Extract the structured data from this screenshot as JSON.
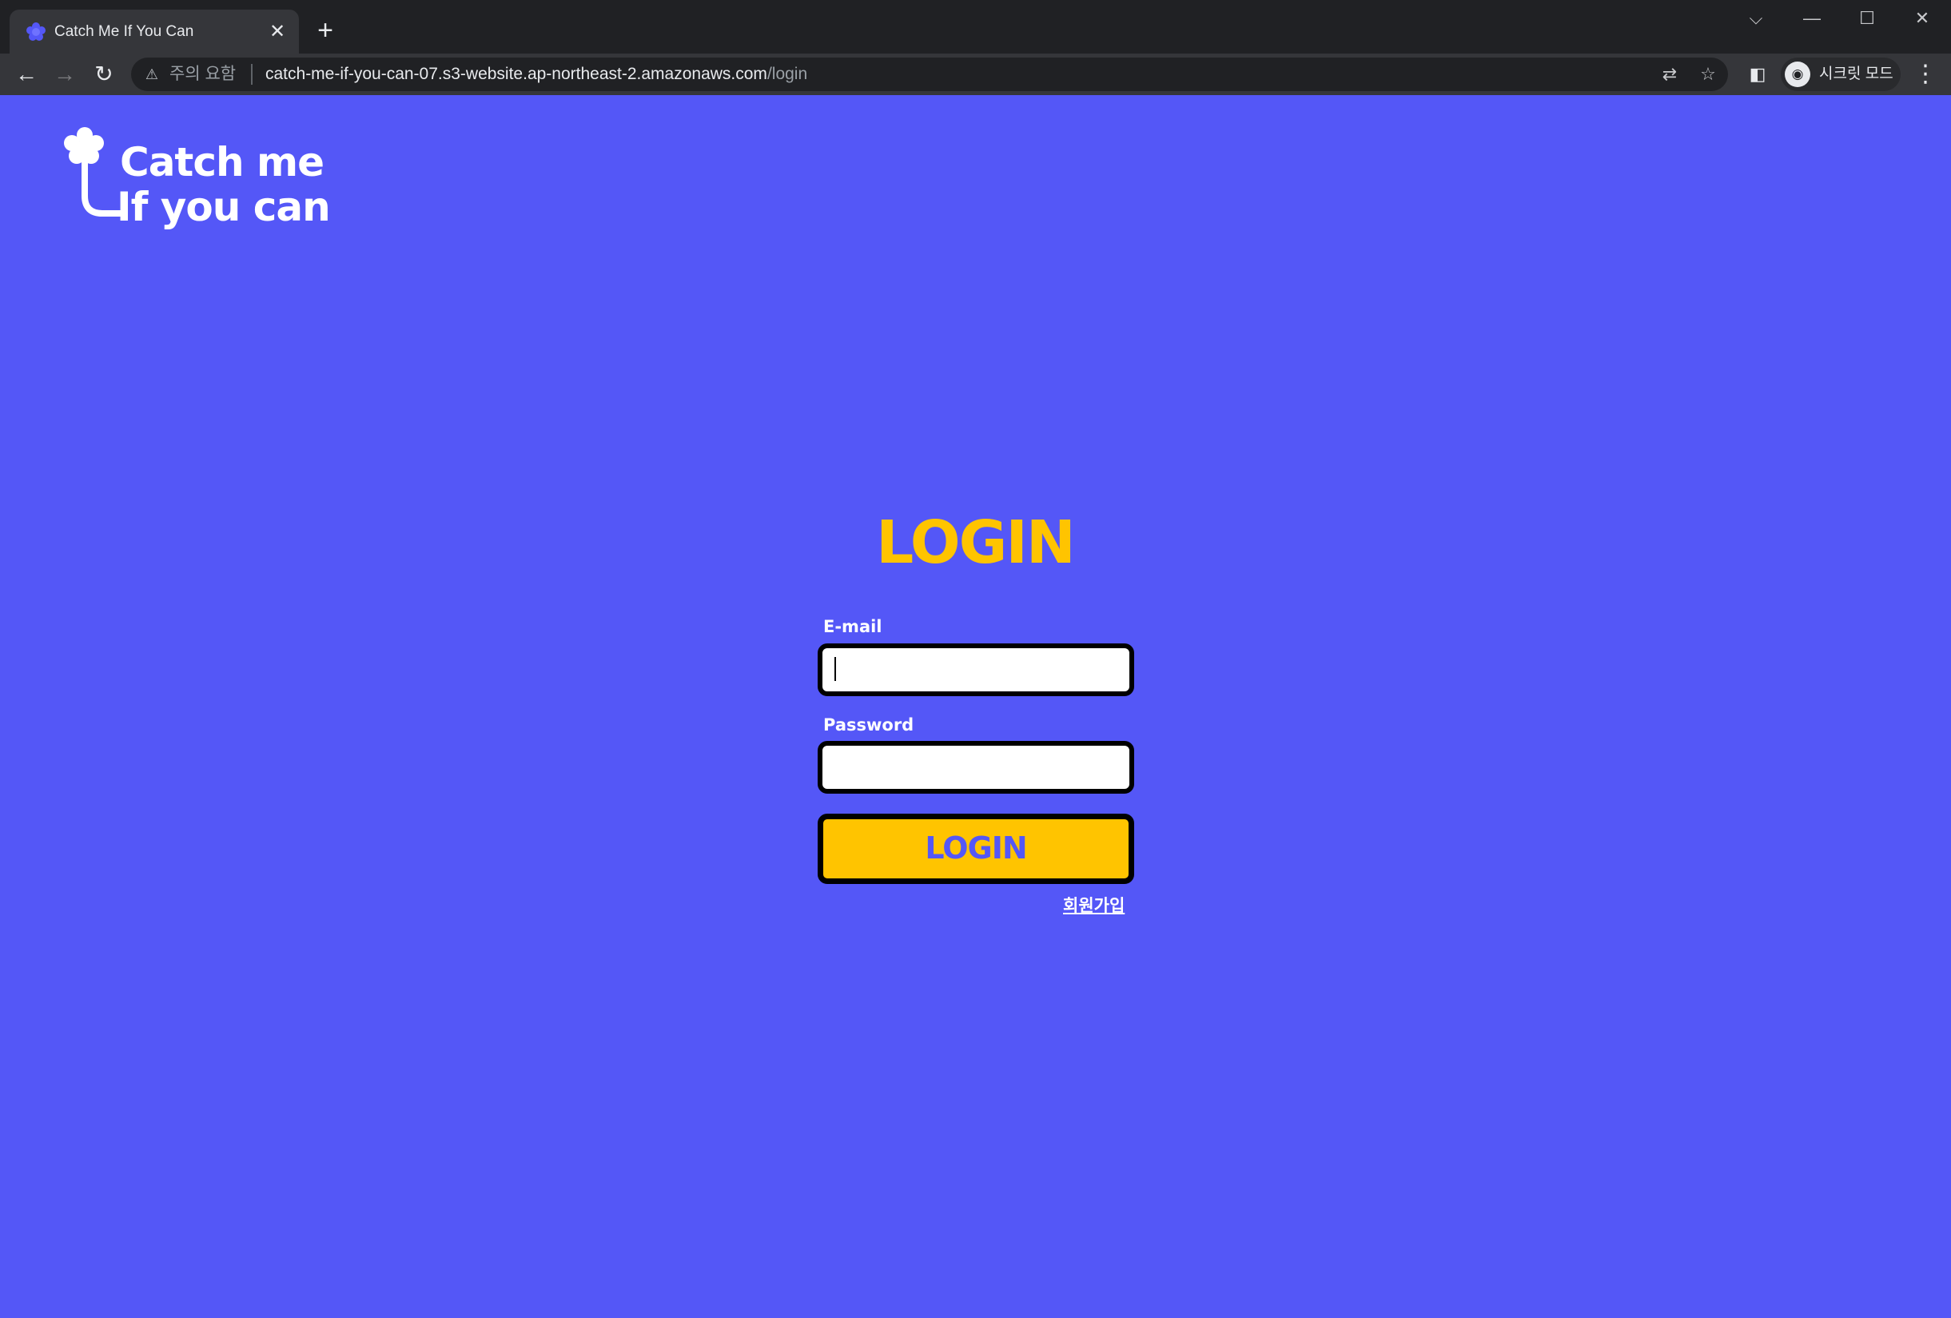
{
  "browser": {
    "tab_title": "Catch Me If You Can",
    "tab_close": "✕",
    "new_tab": "+",
    "tab_search": "⌵",
    "minimize": "—",
    "maximize": "☐",
    "close": "✕",
    "back": "←",
    "forward": "→",
    "reload": "↻",
    "security_icon": "⚠",
    "security_text": "주의 요함",
    "url_host": "catch-me-if-you-can-07.s3-website.ap-northeast-2.amazonaws.com",
    "url_path": "/login",
    "translate_icon": "⇄",
    "bookmark_icon": "☆",
    "side_panel_icon": "◧",
    "incognito_icon": "◉",
    "incognito_label": "시크릿 모드",
    "menu_icon": "⋮"
  },
  "page": {
    "logo_line1": "Catch me",
    "logo_line2": "If you can",
    "heading": "LOGIN",
    "email_label": "E-mail",
    "email_value": "",
    "password_label": "Password",
    "password_value": "",
    "login_button": "LOGIN",
    "signup_link": "회원가입"
  },
  "colors": {
    "background": "#5457f7",
    "accent_yellow": "#ffc400",
    "text_white": "#ffffff",
    "border_black": "#000000"
  }
}
